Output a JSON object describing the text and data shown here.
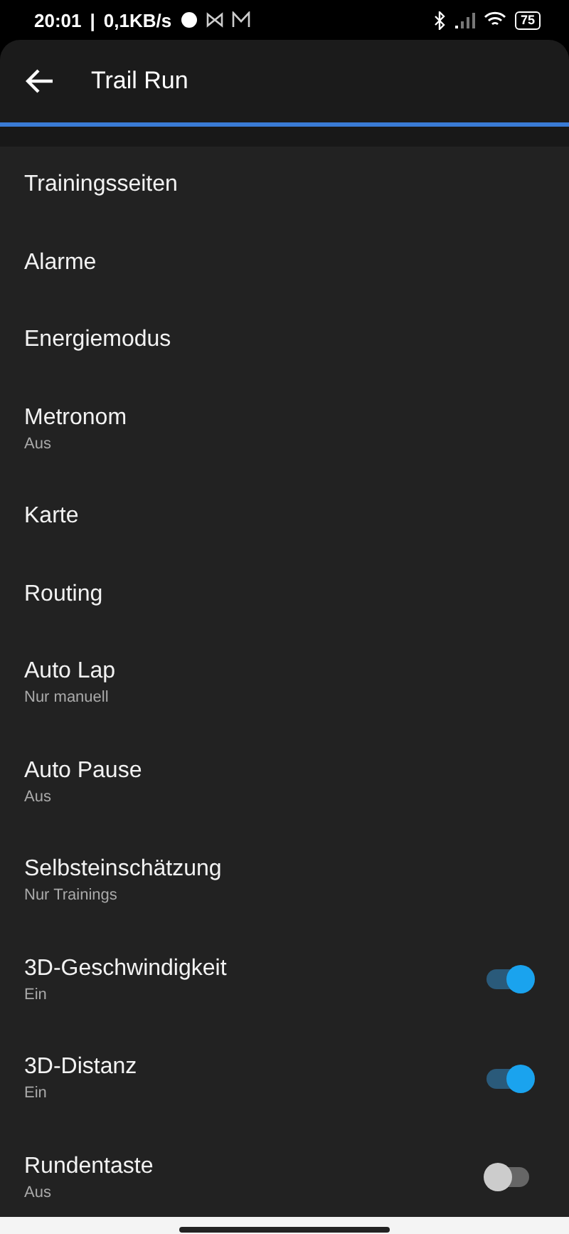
{
  "status_bar": {
    "time": "20:01",
    "separator": "|",
    "speed": "0,1KB/s",
    "battery": "75"
  },
  "app_bar": {
    "title": "Trail Run"
  },
  "items": [
    {
      "kind": "link",
      "title": "Trainingsseiten"
    },
    {
      "kind": "link",
      "title": "Alarme"
    },
    {
      "kind": "link",
      "title": "Energiemodus"
    },
    {
      "kind": "link",
      "title": "Metronom",
      "subtitle": "Aus"
    },
    {
      "kind": "link",
      "title": "Karte"
    },
    {
      "kind": "link",
      "title": "Routing"
    },
    {
      "kind": "link",
      "title": "Auto Lap",
      "subtitle": "Nur manuell"
    },
    {
      "kind": "link",
      "title": "Auto Pause",
      "subtitle": "Aus"
    },
    {
      "kind": "link",
      "title": "Selbsteinschätzung",
      "subtitle": "Nur Trainings"
    },
    {
      "kind": "toggle",
      "title": "3D-Geschwindigkeit",
      "subtitle": "Ein",
      "on": true
    },
    {
      "kind": "toggle",
      "title": "3D-Distanz",
      "subtitle": "Ein",
      "on": true
    },
    {
      "kind": "toggle",
      "title": "Rundentaste",
      "subtitle": "Aus",
      "on": false
    }
  ]
}
